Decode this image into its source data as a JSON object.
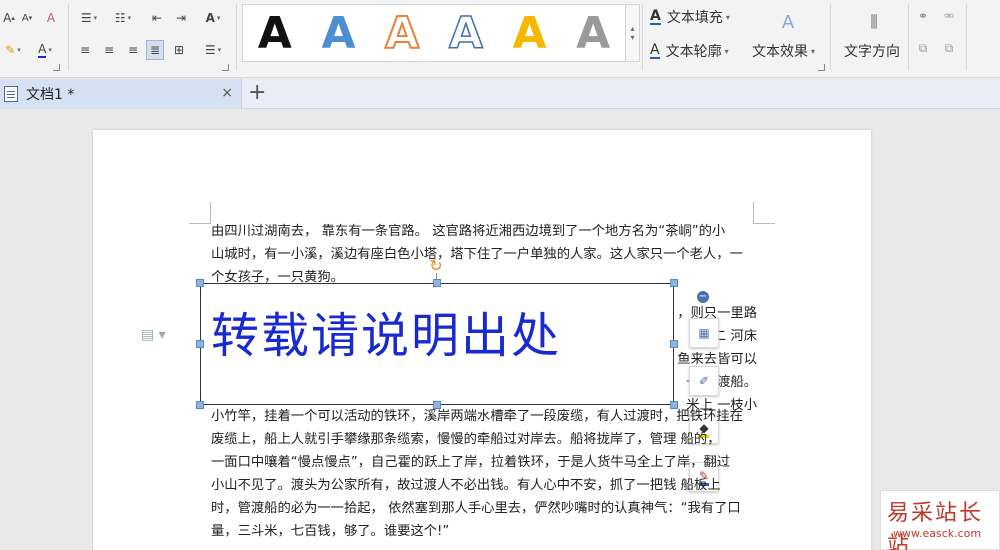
{
  "ribbon": {
    "font_size_up": "A",
    "font_size_down": "A",
    "clear_format": "A",
    "font_color_glyph": "A",
    "style_swatch_glyph": "A",
    "text_fill_label": "文本填充",
    "text_outline_label": "文本轮廓",
    "text_effect_label": "文本效果",
    "text_direction_label": "文字方向",
    "wordart_glyph": "A",
    "text_glyph": "A"
  },
  "tab": {
    "title": "文档1 *",
    "close": "×",
    "new_tab": "+"
  },
  "document": {
    "para_top": [
      "由四川过湖南去， 靠东有一条官路。 这官路将近湘西边境到了一个地方名为“茶峒”的小",
      "山城时，有一小溪，溪边有座白色小塔，塔下住了一户单独的人家。这人家只一个老人，一",
      "个女孩子，一只黄狗。"
    ],
    "side_lines": [
      "，则只一里路",
      "二  河床",
      "鱼来去皆可以",
      "一只  渡船。",
      "米上  一枝小"
    ],
    "para_bottom": [
      "小竹竿，挂着一个可以活动的铁环，溪岸两端水槽牵了一段废缆，有人过渡时，把铁环挂在",
      "废缆上，船上人就引手攀缘那条缆索，慢慢的牵船过对岸去。船将拢岸了，管理  船的，",
      "一面口中嚷着“慢点慢点”，自己霍的跃上了岸，拉着铁环，于是人货牛马全上了岸，翻过",
      "小山不见了。渡头为公家所有，故过渡人不必出钱。有人心中不安，抓了一把钱  船板上",
      "时，管渡船的必为一一拾起， 依然塞到那人手心里去，俨然吵嘴时的认真神气：“我有了口",
      "量，三斗米，七百钱，够了。谁要这个!”"
    ],
    "textbox_text": "转载请说明出处"
  },
  "watermark": {
    "name": "易采站长站",
    "url": "www.easck.com"
  },
  "colors": {
    "wordart_blue": "#1a2ad1",
    "tab_active": "#d6e2f3",
    "handle": "#8fb3e3"
  }
}
